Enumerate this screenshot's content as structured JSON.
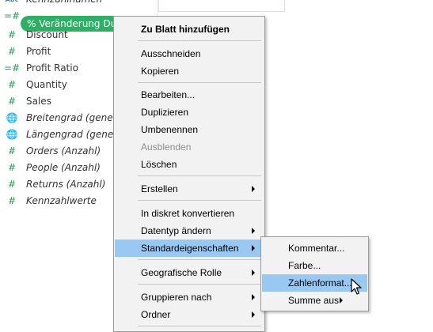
{
  "data_pane": {
    "top_field": "Kennzahlnamen",
    "selected_field": "% Veränderung Durch...",
    "fields": [
      {
        "icon": "hash-icon",
        "label": "Discount"
      },
      {
        "icon": "hash-icon",
        "label": "Profit"
      },
      {
        "icon": "calc-hash-icon",
        "label": "Profit Ratio"
      },
      {
        "icon": "hash-icon",
        "label": "Quantity"
      },
      {
        "icon": "hash-icon",
        "label": "Sales"
      },
      {
        "icon": "globe-icon",
        "label": "Breitengrad (generiert)"
      },
      {
        "icon": "globe-icon",
        "label": "Längengrad (generiert)"
      },
      {
        "icon": "hash-icon",
        "label": "Orders (Anzahl)"
      },
      {
        "icon": "hash-icon",
        "label": "People (Anzahl)"
      },
      {
        "icon": "hash-icon",
        "label": "Returns (Anzahl)"
      },
      {
        "icon": "hash-icon",
        "label": "Kennzahlwerte"
      }
    ]
  },
  "context_menu": {
    "items": [
      {
        "label": "Zu Blatt hinzufügen"
      },
      {
        "label": "Ausschneiden"
      },
      {
        "label": "Kopieren"
      },
      {
        "label": "Bearbeiten..."
      },
      {
        "label": "Duplizieren"
      },
      {
        "label": "Umbenennen"
      },
      {
        "label": "Ausblenden"
      },
      {
        "label": "Löschen"
      },
      {
        "label": "Erstellen"
      },
      {
        "label": "In diskret konvertieren"
      },
      {
        "label": "Datentyp ändern"
      },
      {
        "label": "Standardeigenschaften"
      },
      {
        "label": "Geografische Rolle"
      },
      {
        "label": "Gruppieren nach"
      },
      {
        "label": "Ordner"
      }
    ]
  },
  "submenu": {
    "items": [
      {
        "label": "Kommentar..."
      },
      {
        "label": "Farbe..."
      },
      {
        "label": "Zahlenformat..."
      },
      {
        "label": "Summe aus"
      }
    ]
  },
  "colors": {
    "pill_green": "#2fae65",
    "field_icon_green": "#2a9d5c",
    "menu_bg": "#f2f2f2",
    "menu_highlight": "#99c9f2"
  }
}
